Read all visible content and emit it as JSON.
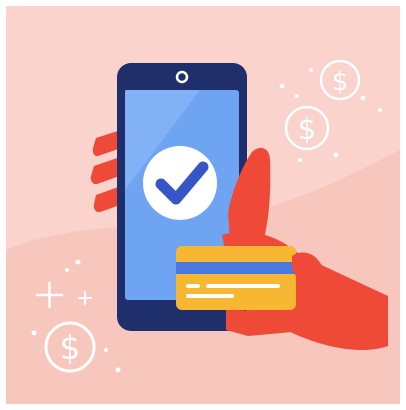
{
  "illustration": {
    "icons": [
      "dollar-coin-icon",
      "checkmark-icon",
      "credit-card-icon",
      "sparkle-plus-icon",
      "dot-icon"
    ],
    "colors": {
      "background": "#f9d3cc",
      "background_wave": "#f8c2b8",
      "phone_body": "#1f2f6b",
      "screen": "#6fa4f3",
      "screen_light": "#8ab7f7",
      "check_circle": "#ffffff",
      "check_mark": "#3656c8",
      "hand": "#ef4a37",
      "card_yellow": "#f7b733",
      "card_stripe": "#4a79e0",
      "card_line": "#ffffff",
      "sparkle": "#ffffff"
    }
  }
}
